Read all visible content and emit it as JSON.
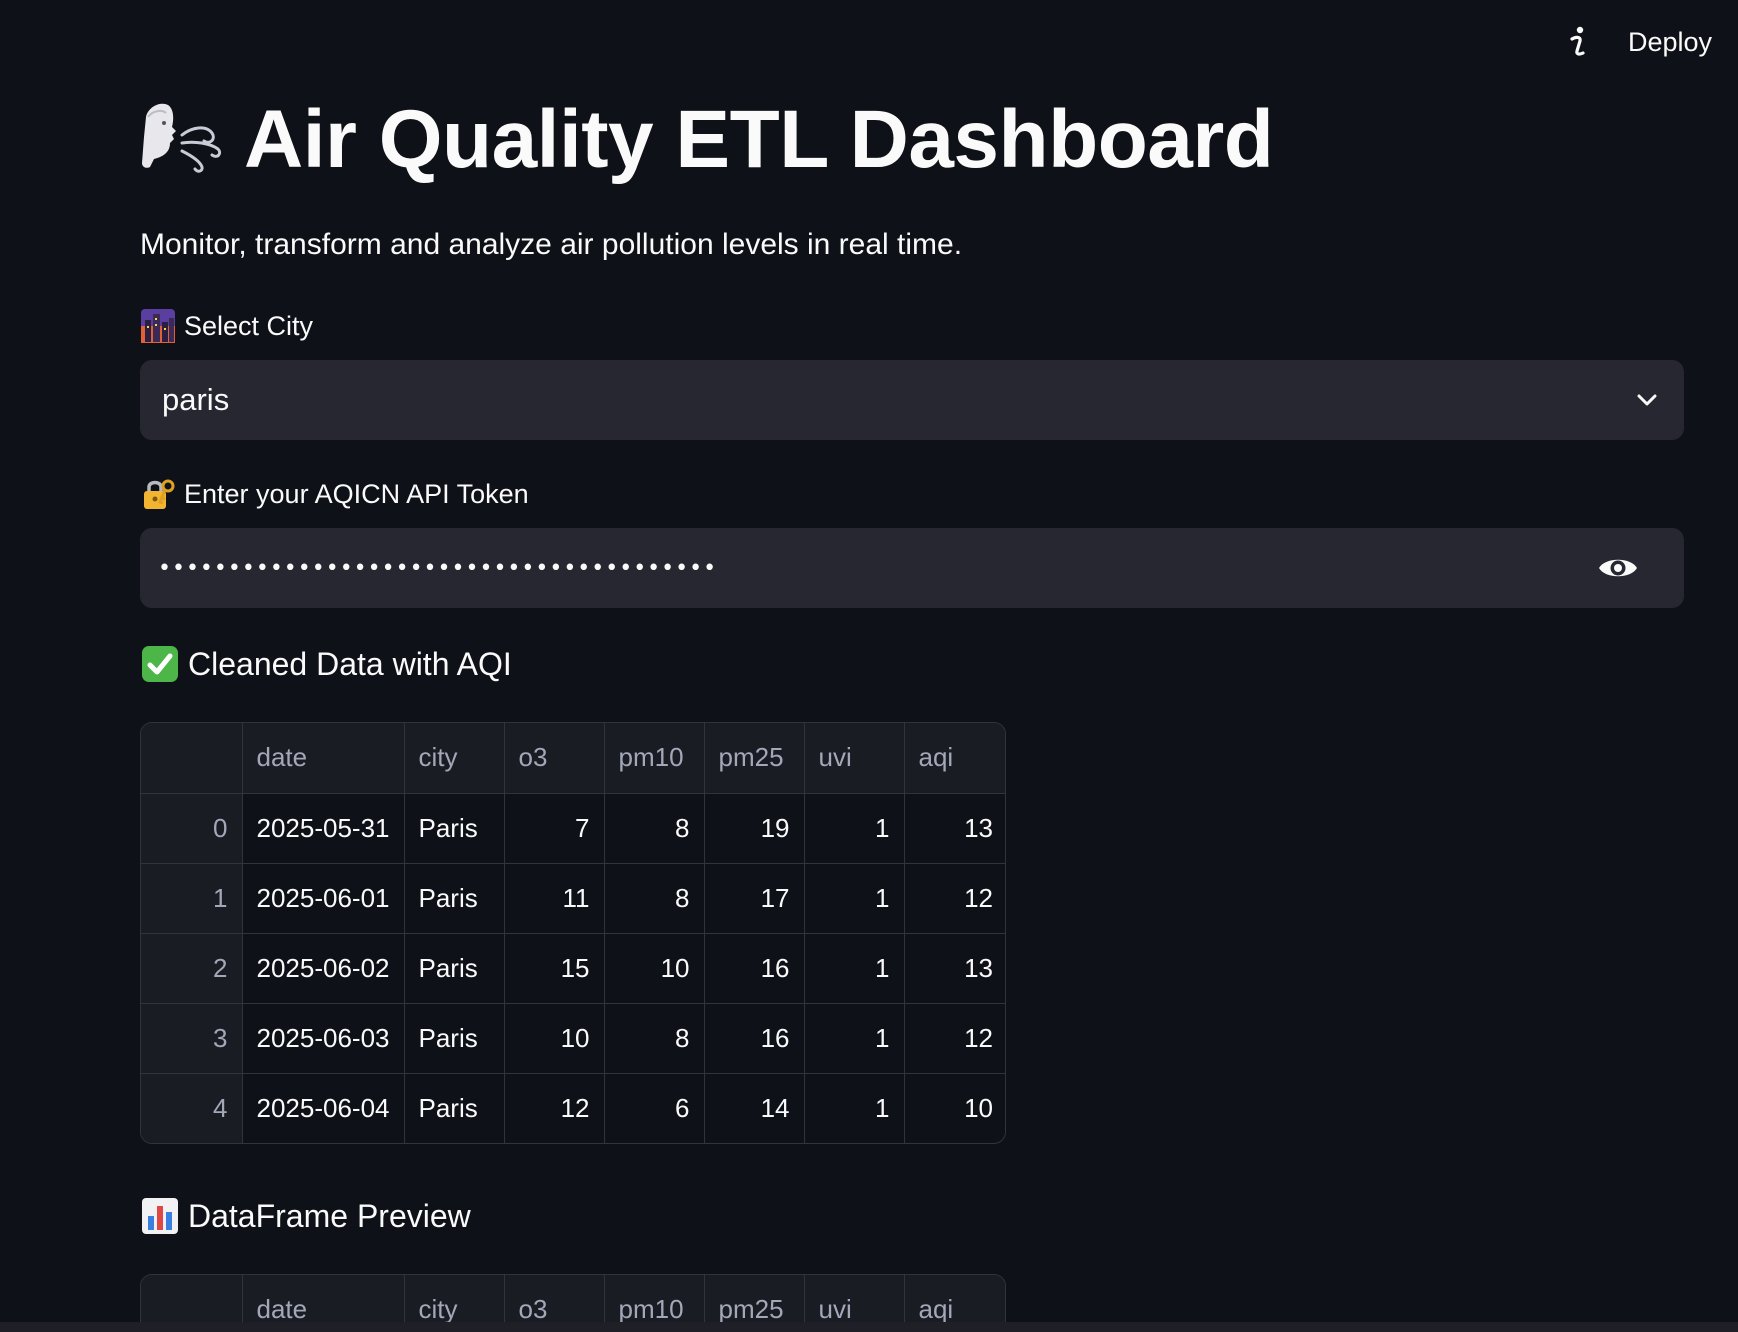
{
  "toolbar": {
    "info_icon": "info-icon",
    "deploy_label": "Deploy"
  },
  "header": {
    "title": "Air Quality ETL Dashboard",
    "title_icon": "face-blowing-wind-icon",
    "subtitle": "Monitor, transform and analyze air pollution levels in real time."
  },
  "city_select": {
    "label": "Select City",
    "label_icon": "cityscape-icon",
    "value": "paris"
  },
  "token_input": {
    "label": "Enter your AQICN API Token",
    "label_icon": "lock-with-key-icon",
    "value": "••••••••••••••••••••••••••••••••••••••••"
  },
  "cleaned_section": {
    "heading": "Cleaned Data with AQI",
    "heading_icon": "check-mark-button-icon"
  },
  "table": {
    "columns": [
      "",
      "date",
      "city",
      "o3",
      "pm10",
      "pm25",
      "uvi",
      "aqi"
    ],
    "rows": [
      {
        "index": "0",
        "date": "2025-05-31",
        "city": "Paris",
        "o3": "7",
        "pm10": "8",
        "pm25": "19",
        "uvi": "1",
        "aqi": "13"
      },
      {
        "index": "1",
        "date": "2025-06-01",
        "city": "Paris",
        "o3": "11",
        "pm10": "8",
        "pm25": "17",
        "uvi": "1",
        "aqi": "12"
      },
      {
        "index": "2",
        "date": "2025-06-02",
        "city": "Paris",
        "o3": "15",
        "pm10": "10",
        "pm25": "16",
        "uvi": "1",
        "aqi": "13"
      },
      {
        "index": "3",
        "date": "2025-06-03",
        "city": "Paris",
        "o3": "10",
        "pm10": "8",
        "pm25": "16",
        "uvi": "1",
        "aqi": "12"
      },
      {
        "index": "4",
        "date": "2025-06-04",
        "city": "Paris",
        "o3": "12",
        "pm10": "6",
        "pm25": "14",
        "uvi": "1",
        "aqi": "10"
      }
    ]
  },
  "preview_section": {
    "heading": "DataFrame Preview",
    "heading_icon": "bar-chart-icon"
  },
  "colors": {
    "background": "#0e1117",
    "input_bg": "#262730",
    "border": "#31333f",
    "text": "#fafafa",
    "muted": "#a3a8b8"
  }
}
